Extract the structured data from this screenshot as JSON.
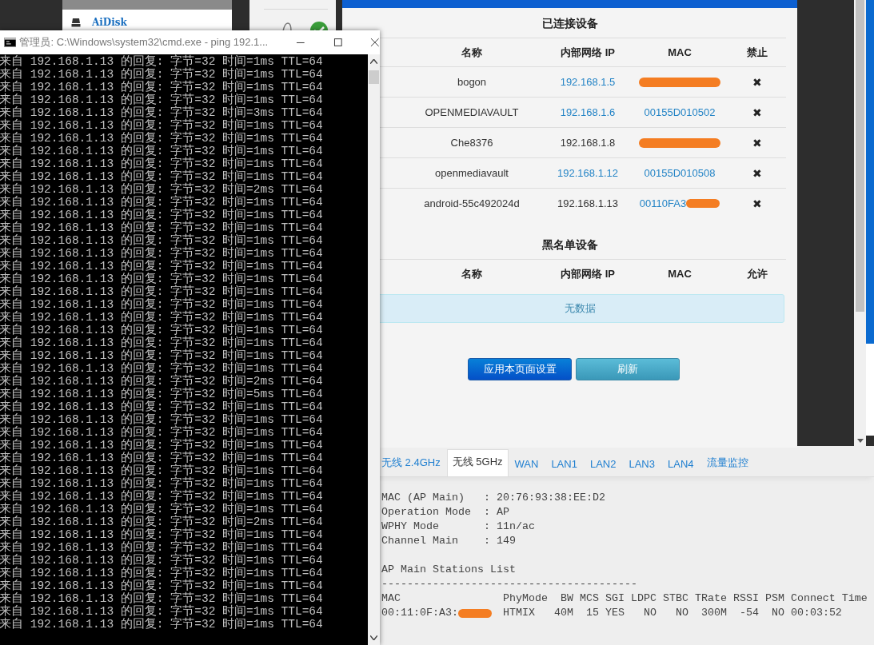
{
  "background": {
    "sidebar_item": "AiDisk"
  },
  "cmd_window": {
    "title": "管理员: C:\\Windows\\system32\\cmd.exe - ping  192.1...",
    "lines": [
      "来自 192.168.1.13 的回复: 字节=32 时间=1ms TTL=64",
      "来自 192.168.1.13 的回复: 字节=32 时间=1ms TTL=64",
      "来自 192.168.1.13 的回复: 字节=32 时间=1ms TTL=64",
      "来自 192.168.1.13 的回复: 字节=32 时间=1ms TTL=64",
      "来自 192.168.1.13 的回复: 字节=32 时间=3ms TTL=64",
      "来自 192.168.1.13 的回复: 字节=32 时间=1ms TTL=64",
      "来自 192.168.1.13 的回复: 字节=32 时间=1ms TTL=64",
      "来自 192.168.1.13 的回复: 字节=32 时间=1ms TTL=64",
      "来自 192.168.1.13 的回复: 字节=32 时间=1ms TTL=64",
      "来自 192.168.1.13 的回复: 字节=32 时间=1ms TTL=64",
      "来自 192.168.1.13 的回复: 字节=32 时间=2ms TTL=64",
      "来自 192.168.1.13 的回复: 字节=32 时间=1ms TTL=64",
      "来自 192.168.1.13 的回复: 字节=32 时间=1ms TTL=64",
      "来自 192.168.1.13 的回复: 字节=32 时间=1ms TTL=64",
      "来自 192.168.1.13 的回复: 字节=32 时间=1ms TTL=64",
      "来自 192.168.1.13 的回复: 字节=32 时间=1ms TTL=64",
      "来自 192.168.1.13 的回复: 字节=32 时间=1ms TTL=64",
      "来自 192.168.1.13 的回复: 字节=32 时间=1ms TTL=64",
      "来自 192.168.1.13 的回复: 字节=32 时间=1ms TTL=64",
      "来自 192.168.1.13 的回复: 字节=32 时间=1ms TTL=64",
      "来自 192.168.1.13 的回复: 字节=32 时间=1ms TTL=64",
      "来自 192.168.1.13 的回复: 字节=32 时间=1ms TTL=64",
      "来自 192.168.1.13 的回复: 字节=32 时间=1ms TTL=64",
      "来自 192.168.1.13 的回复: 字节=32 时间=1ms TTL=64",
      "来自 192.168.1.13 的回复: 字节=32 时间=1ms TTL=64",
      "来自 192.168.1.13 的回复: 字节=32 时间=2ms TTL=64",
      "来自 192.168.1.13 的回复: 字节=32 时间=5ms TTL=64",
      "来自 192.168.1.13 的回复: 字节=32 时间=1ms TTL=64",
      "来自 192.168.1.13 的回复: 字节=32 时间=1ms TTL=64",
      "来自 192.168.1.13 的回复: 字节=32 时间=1ms TTL=64",
      "来自 192.168.1.13 的回复: 字节=32 时间=1ms TTL=64",
      "来自 192.168.1.13 的回复: 字节=32 时间=1ms TTL=64",
      "来自 192.168.1.13 的回复: 字节=32 时间=1ms TTL=64",
      "来自 192.168.1.13 的回复: 字节=32 时间=1ms TTL=64",
      "来自 192.168.1.13 的回复: 字节=32 时间=1ms TTL=64",
      "来自 192.168.1.13 的回复: 字节=32 时间=1ms TTL=64",
      "来自 192.168.1.13 的回复: 字节=32 时间=2ms TTL=64",
      "来自 192.168.1.13 的回复: 字节=32 时间=1ms TTL=64",
      "来自 192.168.1.13 的回复: 字节=32 时间=1ms TTL=64",
      "来自 192.168.1.13 的回复: 字节=32 时间=1ms TTL=64",
      "来自 192.168.1.13 的回复: 字节=32 时间=1ms TTL=64",
      "来自 192.168.1.13 的回复: 字节=32 时间=1ms TTL=64",
      "来自 192.168.1.13 的回复: 字节=32 时间=1ms TTL=64",
      "来自 192.168.1.13 的回复: 字节=32 时间=1ms TTL=64",
      "来自 192.168.1.13 的回复: 字节=32 时间=1ms TTL=64"
    ]
  },
  "connected_devices": {
    "title": "已连接设备",
    "columns": [
      "名称",
      "内部网络 IP",
      "MAC",
      "禁止"
    ],
    "rows": [
      {
        "name": "bogon",
        "ip": "192.168.1.5",
        "ip_linked": true,
        "mac_redacted": true,
        "action": "✖"
      },
      {
        "name": "OPENMEDIAVAULT",
        "ip": "192.168.1.6",
        "ip_linked": true,
        "mac": "00155D010502",
        "mac_redacted": false,
        "action": "✖"
      },
      {
        "name": "Che8376",
        "ip": "192.168.1.8",
        "ip_linked": false,
        "mac_redacted": true,
        "action": "✖"
      },
      {
        "name": "openmediavault",
        "ip": "192.168.1.12",
        "ip_linked": true,
        "mac": "00155D010508",
        "mac_redacted": false,
        "action": "✖"
      },
      {
        "name": "android-55c492024d",
        "ip": "192.168.1.13",
        "ip_linked": false,
        "mac": "00110FA3",
        "mac_redacted": true,
        "action": "✖"
      }
    ]
  },
  "blacklist": {
    "title": "黑名单设备",
    "columns": [
      "名称",
      "内部网络 IP",
      "MAC",
      "允许"
    ],
    "empty_message": "无数据"
  },
  "buttons": [
    {
      "label": "应用本页面设置",
      "kind": "primary"
    },
    {
      "label": "刷新",
      "kind": "secondary"
    }
  ],
  "router_page": {
    "tabs": [
      {
        "label": "无线 2.4GHz",
        "selected": false
      },
      {
        "label": "无线 5GHz",
        "selected": true
      },
      {
        "label": "WAN",
        "selected": false
      },
      {
        "label": "LAN1",
        "selected": false
      },
      {
        "label": "LAN2",
        "selected": false
      },
      {
        "label": "LAN3",
        "selected": false
      },
      {
        "label": "LAN4",
        "selected": false
      },
      {
        "label": "流量监控",
        "selected": false
      }
    ],
    "info_lines": [
      "MAC (AP Main)   : 20:76:93:38:EE:D2",
      "Operation Mode  : AP",
      "WPHY Mode       : 11n/ac",
      "Channel Main    : 149"
    ],
    "section_title": "AP Main Stations List",
    "separator": "----------------------------------------",
    "station_header": "MAC                PhyMode  BW MCS SGI LDPC STBC TRate RSSI PSM Connect Time",
    "stations": [
      {
        "mac": "00:11:0F:A3:",
        "mac_redacted": true,
        "details": "HTMIX   40M  15 YES   NO   NO  300M  -54  NO 00:03:52"
      }
    ]
  }
}
